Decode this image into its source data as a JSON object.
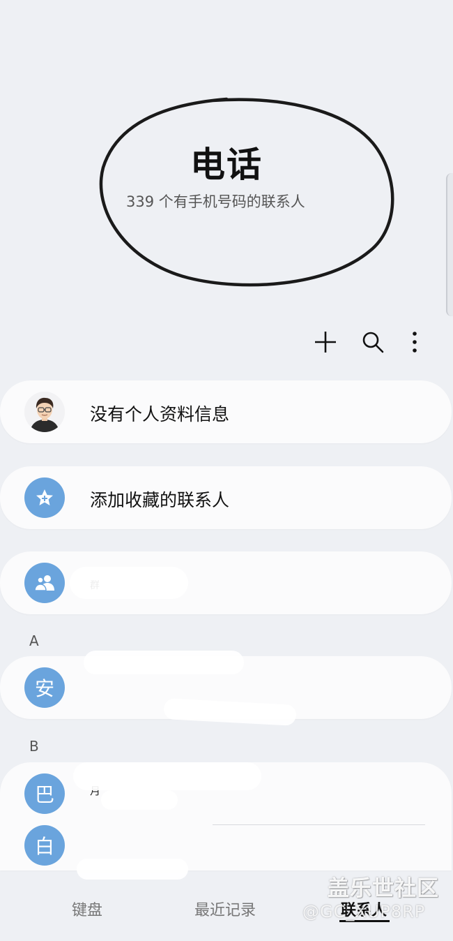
{
  "header": {
    "title": "电话",
    "subtitle": "339 个有手机号码的联系人"
  },
  "toolbar": {
    "add_icon": "plus-icon",
    "search_icon": "search-icon",
    "more_icon": "more-vertical-icon"
  },
  "rows": {
    "profile": {
      "label": "没有个人资料信息",
      "icon": "profile-avatar"
    },
    "favorites": {
      "label": "添加收藏的联系人",
      "icon": "star-icon"
    },
    "groups": {
      "label": "群",
      "icon": "group-icon"
    }
  },
  "sections": [
    {
      "letter": "A",
      "contacts": [
        {
          "initial": "安"
        }
      ]
    },
    {
      "letter": "B",
      "contacts": [
        {
          "initial": "巴",
          "name": "月"
        },
        {
          "initial": "白"
        }
      ]
    }
  ],
  "tabs": [
    {
      "label": "键盘"
    },
    {
      "label": "最近记录"
    },
    {
      "label": "联系人",
      "selected": true
    }
  ],
  "watermark": {
    "line1": "盖乐世社区",
    "line2": "@GC_XUP8RP"
  },
  "colors": {
    "background": "#eef0f4",
    "card": "#fbfbfc",
    "avatar": "#6aa4dd"
  }
}
